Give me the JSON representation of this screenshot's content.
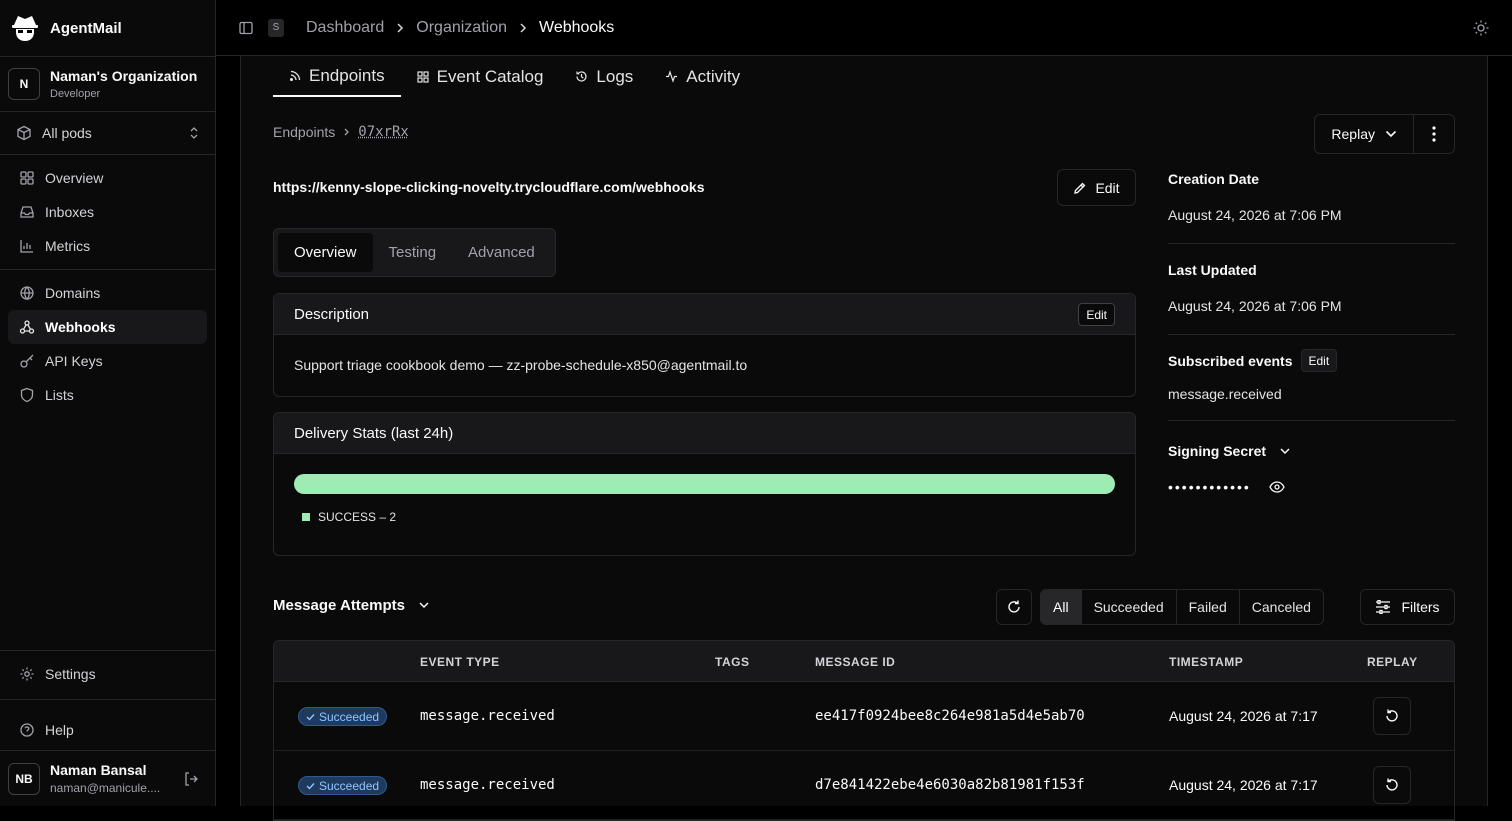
{
  "app": {
    "name": "AgentMail"
  },
  "org": {
    "initial": "N",
    "name": "Naman's Organization",
    "role": "Developer"
  },
  "pods": {
    "label": "All pods"
  },
  "nav": {
    "group1": [
      {
        "label": "Overview",
        "icon": "grid-icon"
      },
      {
        "label": "Inboxes",
        "icon": "inbox-icon"
      },
      {
        "label": "Metrics",
        "icon": "bar-chart-icon"
      }
    ],
    "group2": [
      {
        "label": "Domains",
        "icon": "globe-icon"
      },
      {
        "label": "Webhooks",
        "icon": "webhook-icon",
        "active": true
      },
      {
        "label": "API Keys",
        "icon": "key-icon"
      },
      {
        "label": "Lists",
        "icon": "shield-icon"
      }
    ],
    "settings": "Settings",
    "help": "Help"
  },
  "user": {
    "initials": "NB",
    "name": "Naman Bansal",
    "email": "naman@manicule...."
  },
  "breadcrumb": {
    "kbd": "S",
    "items": [
      "Dashboard",
      "Organization",
      "Webhooks"
    ]
  },
  "tabs": [
    "Endpoints",
    "Event Catalog",
    "Logs",
    "Activity"
  ],
  "endpoint": {
    "crumb_root": "Endpoints",
    "id": "07xrRx",
    "replay_label": "Replay",
    "url": "https://kenny-slope-clicking-novelty.trycloudflare.com/webhooks",
    "edit_label": "Edit",
    "subtabs": [
      "Overview",
      "Testing",
      "Advanced"
    ]
  },
  "description": {
    "title": "Description",
    "edit_label": "Edit",
    "text": "Support triage cookbook demo — zz-probe-schedule-x850@agentmail.to"
  },
  "stats": {
    "title": "Delivery Stats (last 24h)",
    "success_fraction": 1.0,
    "legend": "SUCCESS – 2",
    "color": "#9eecb4"
  },
  "meta": {
    "creation_label": "Creation Date",
    "creation_value": "August 24, 2026 at 7:06 PM",
    "updated_label": "Last Updated",
    "updated_value": "August 24, 2026 at 7:06 PM",
    "events_label": "Subscribed events",
    "events_edit": "Edit",
    "events_value": "message.received",
    "secret_label": "Signing Secret",
    "secret_value": "••••••••••••"
  },
  "attempts": {
    "title": "Message Attempts",
    "filters": [
      "All",
      "Succeeded",
      "Failed",
      "Canceled"
    ],
    "filters_label": "Filters",
    "columns": [
      "EVENT TYPE",
      "TAGS",
      "MESSAGE ID",
      "TIMESTAMP",
      "REPLAY"
    ],
    "rows": [
      {
        "status": "Succeeded",
        "event": "message.received",
        "tags": "",
        "id": "ee417f0924bee8c264e981a5d4e5ab70",
        "timestamp": "August 24, 2026 at 7:17"
      },
      {
        "status": "Succeeded",
        "event": "message.received",
        "tags": "",
        "id": "d7e841422ebe4e6030a82b81981f153f",
        "timestamp": "August 24, 2026 at 7:17"
      }
    ]
  }
}
